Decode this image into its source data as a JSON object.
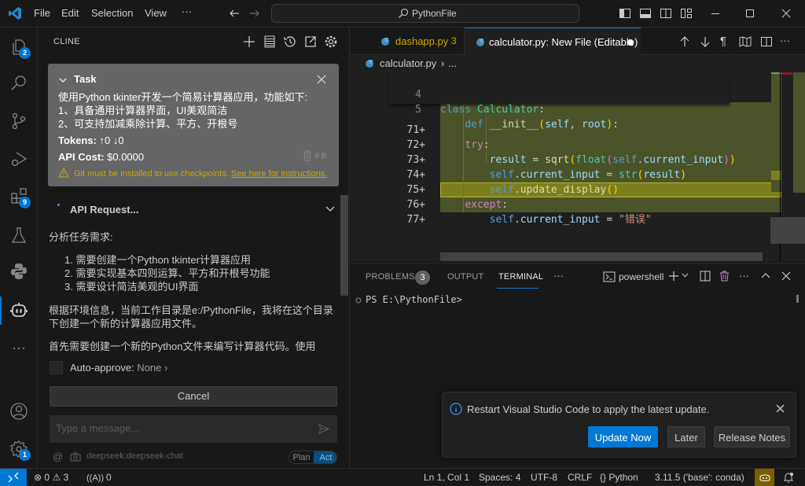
{
  "titlebar": {
    "menu": [
      "File",
      "Edit",
      "Selection",
      "View",
      "···"
    ],
    "search": "PythonFile"
  },
  "activitybar": {
    "items": [
      {
        "name": "explorer",
        "badge": "2"
      },
      {
        "name": "search"
      },
      {
        "name": "source-control"
      },
      {
        "name": "run-debug"
      },
      {
        "name": "extensions",
        "badge": "9"
      },
      {
        "name": "testing"
      },
      {
        "name": "python"
      },
      {
        "name": "cline",
        "active": true
      },
      {
        "name": "more"
      }
    ],
    "bottom": [
      {
        "name": "accounts"
      },
      {
        "name": "manage",
        "badge": "1"
      }
    ]
  },
  "sidebar": {
    "title": "CLINE",
    "task": {
      "header": "Task",
      "text_lines": [
        "使用Python tkinter开发一个简易计算器应用，功能如下:",
        "1、具备通用计算器界面，UI美观简洁",
        "2、可支持加减乘除计算、平方、开根号"
      ],
      "tokens_label": "Tokens:",
      "tokens_up": "0",
      "tokens_down": "0",
      "cost_label": "API Cost:",
      "cost_value": "$0.0000",
      "size": "0 B",
      "warning": "Git must be installed to use checkpoints.",
      "warning_link": "See here for instructions."
    },
    "api_request": "API Request...",
    "analysis": {
      "intro": "分析任务需求:",
      "steps": [
        "1. 需要创建一个Python tkinter计算器应用",
        "2. 需要实现基本四则运算、平方和开根号功能",
        "3. 需要设计简洁美观的UI界面"
      ],
      "para1": "根据环境信息，当前工作目录是e:/PythonFile，我将在这个目录下创建一个新的计算器应用文件。",
      "para2": "首先需要创建一个新的Python文件来编写计算器代码。使用"
    },
    "auto_approve_label": "Auto-approve:",
    "auto_approve_value": "None",
    "cancel": "Cancel",
    "input_placeholder": "Type a message...",
    "model": "deepseek:deepseek-chat",
    "mode_plan": "Plan",
    "mode_act": "Act",
    "active_mode": "Act"
  },
  "editor": {
    "tabs": [
      {
        "label": "dashapp.py",
        "badge": "3",
        "active": false
      },
      {
        "label": "calculator.py: New File (Editable)",
        "dirty": true,
        "active": true
      }
    ],
    "breadcrumb": [
      "calculator.py",
      "..."
    ],
    "sticky": [
      {
        "num": "4",
        "code": "class Calculator:"
      },
      {
        "num": "5",
        "code": "    def __init__(self, root):"
      }
    ],
    "lines": [
      {
        "num": "71+",
        "code": "        try:"
      },
      {
        "num": "72+",
        "code": "            result = sqrt(float(self.current_input))"
      },
      {
        "num": "73+",
        "code": "            self.current_input = str(result)"
      },
      {
        "num": "74+",
        "code": "            self.update_display()"
      },
      {
        "num": "75+",
        "code": "        except:"
      },
      {
        "num": "76+",
        "code": "            self.current_input = \"错误\""
      },
      {
        "num": "77+",
        "code": ""
      }
    ]
  },
  "panel": {
    "tabs": [
      "PROBLEMS",
      "OUTPUT",
      "TERMINAL"
    ],
    "problems_count": "3",
    "active_tab": "TERMINAL",
    "terminal_name": "powershell",
    "terminal_prompt": "PS E:\\PythonFile>"
  },
  "notification": {
    "message": "Restart Visual Studio Code to apply the latest update.",
    "buttons": [
      "Update Now",
      "Later",
      "Release Notes"
    ]
  },
  "statusbar": {
    "errors": "0",
    "warnings": "3",
    "ports": "0",
    "position": "Ln 1, Col 1",
    "spaces": "Spaces: 4",
    "encoding": "UTF-8",
    "eol": "CRLF",
    "language": "Python",
    "interpreter": "3.11.5 ('base': conda)"
  },
  "colors": {
    "accent": "#0078d4",
    "diff_added_bg": "#4b5329",
    "diff_highlight": "#7c7f1d",
    "warning": "#cca700"
  }
}
